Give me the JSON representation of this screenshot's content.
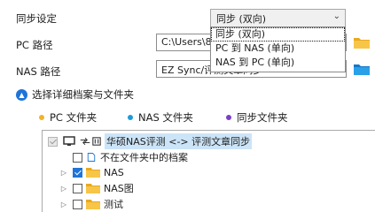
{
  "form": {
    "sync_mode_label": "同步设定",
    "pc_path_label": "PC 路径",
    "pc_path_value": "C:\\Users\\86",
    "nas_path_label": "NAS 路径",
    "nas_path_value": "EZ Sync/评测文章同步"
  },
  "sync_combo": {
    "selected": "同步 (双向)",
    "options": [
      "同步 (双向)",
      "PC 到 NAS (单向)",
      "NAS 到 PC (单向)"
    ]
  },
  "section": {
    "title": "选择详细档案与文件夹",
    "icon": "chevron-up-icon"
  },
  "legend": [
    {
      "label": "PC 文件夹",
      "color": "#f0b429"
    },
    {
      "label": "NAS 文件夹",
      "color": "#1e9bd7"
    },
    {
      "label": "同步文件夹",
      "color": "#7b3fc4"
    }
  ],
  "tree": {
    "root_label": "华硕NAS评测 <-> 评测文章同步",
    "items": [
      {
        "label": "不在文件夹中的档案",
        "checked": false
      },
      {
        "label": "NAS",
        "checked": true
      },
      {
        "label": "NAS图",
        "checked": false
      },
      {
        "label": "测试",
        "checked": false
      }
    ]
  },
  "colors": {
    "accent": "#1e74d8",
    "folder": "#f7c548",
    "selection": "#cce4f7"
  }
}
